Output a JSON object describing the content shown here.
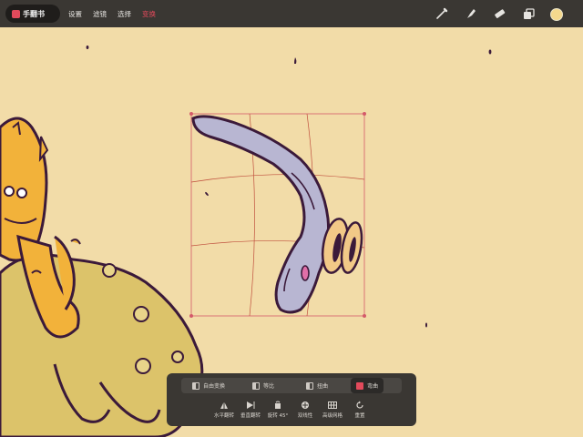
{
  "app": {
    "gallery_label": "手翻书"
  },
  "menu": [
    "设置",
    "滤镜",
    "选择",
    "变换"
  ],
  "menu_active_index": 3,
  "toolbar": {
    "tools": [
      "brush-icon",
      "smudge-icon",
      "eraser-icon",
      "layers-icon"
    ],
    "current_color": "#f4d88d"
  },
  "colors": {
    "accent": "#e24a5b",
    "toolbar_bg": "#3a3733",
    "canvas_bg": "#f2dca8",
    "selection_box": "#d45a6a"
  },
  "transform_panel": {
    "modes": [
      "自由变换",
      "等比",
      "扭曲",
      "弯曲"
    ],
    "active_mode_index": 3,
    "actions": [
      "水平翻转",
      "垂直翻转",
      "旋转 45°",
      "双线性",
      "高级网格",
      "重置"
    ]
  }
}
